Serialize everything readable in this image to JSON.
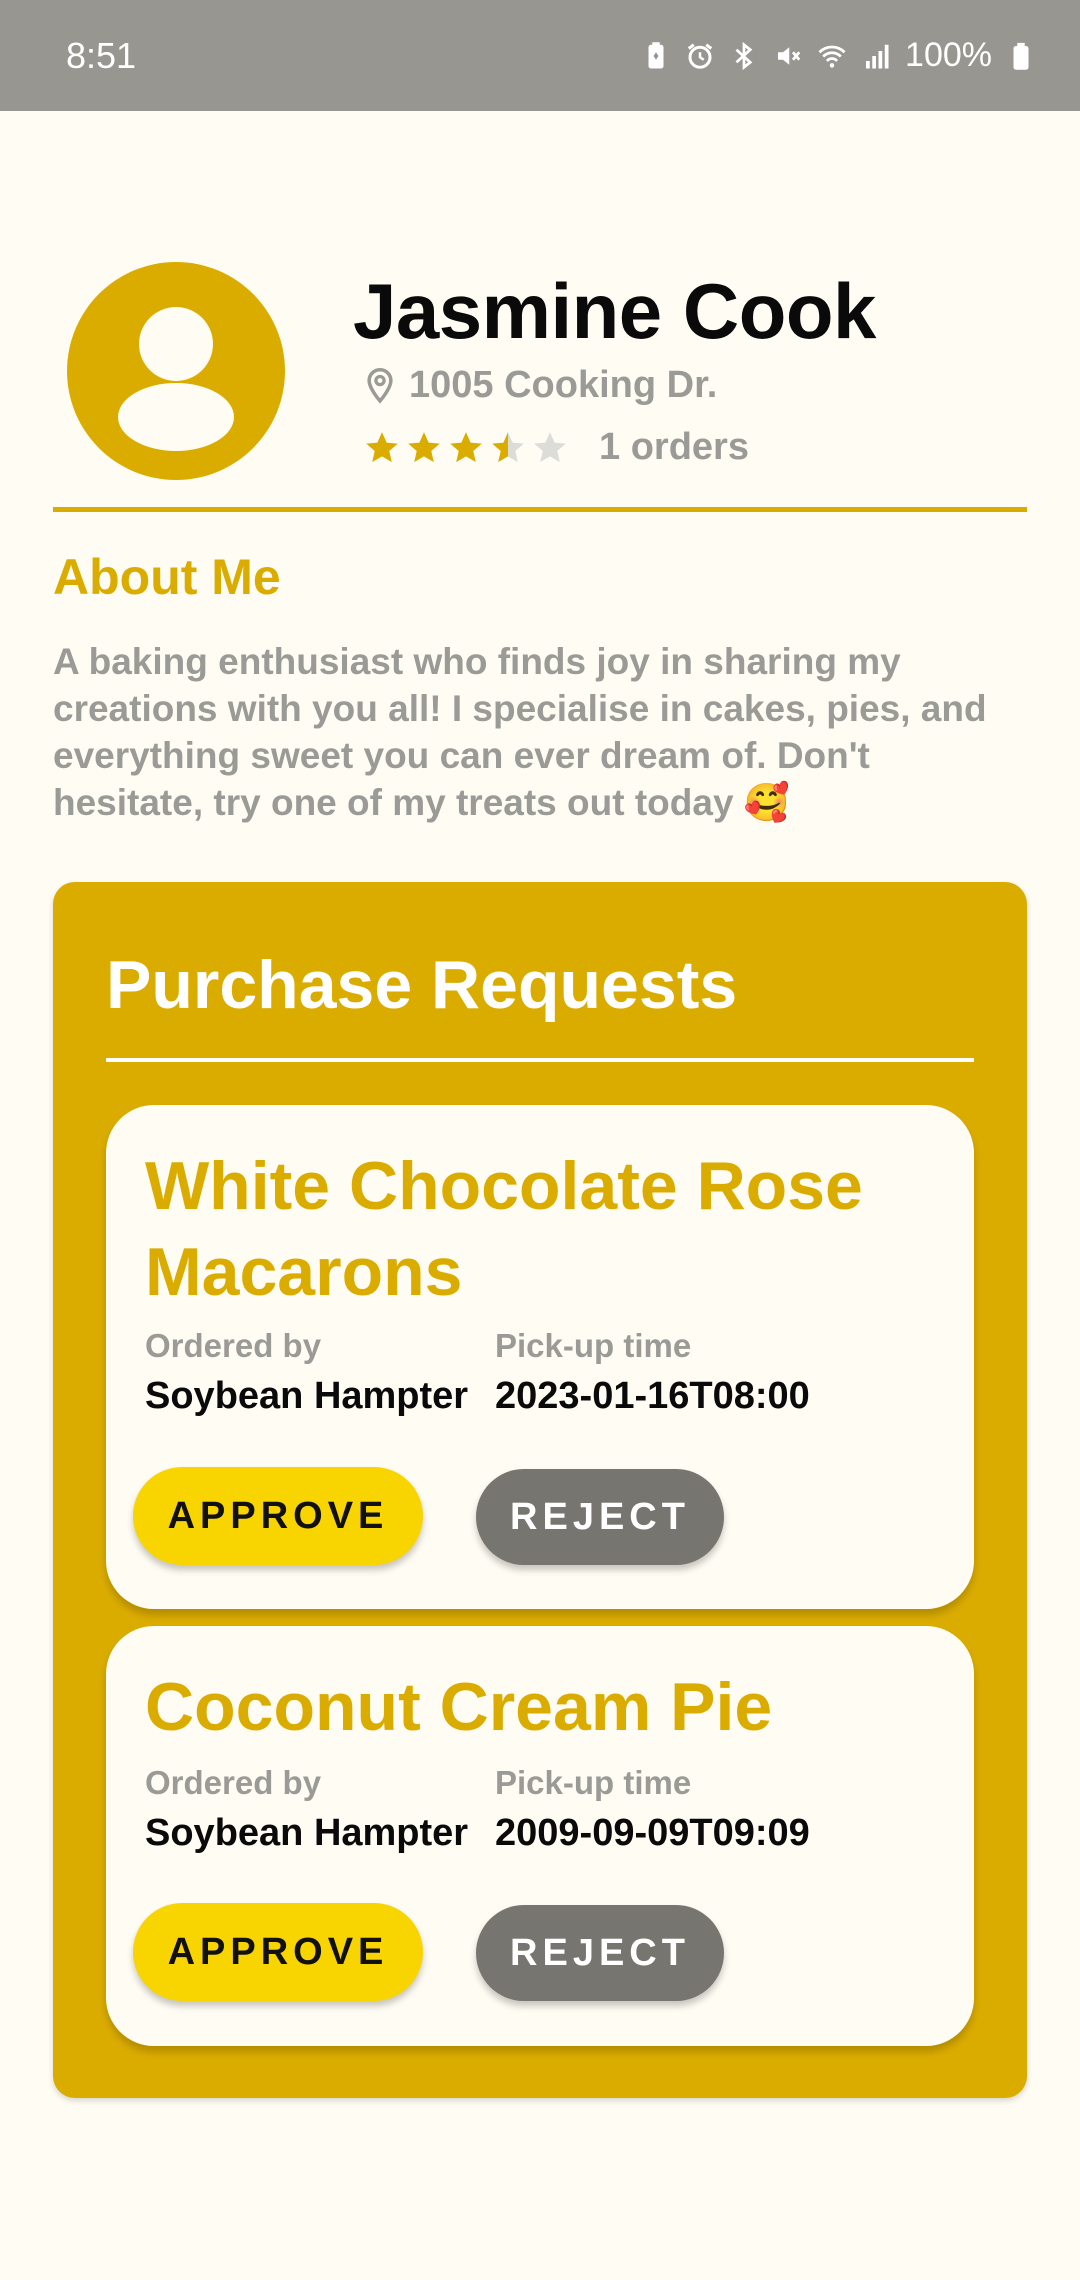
{
  "status_bar": {
    "time": "8:51",
    "battery": "100%",
    "icons": [
      "battery-saver-icon",
      "alarm-icon",
      "bluetooth-icon",
      "mute-icon",
      "wifi-icon",
      "signal-4g-icon",
      "battery-icon"
    ]
  },
  "profile": {
    "name": "Jasmine Cook",
    "address": "1005 Cooking Dr.",
    "rating": 3.5,
    "rating_max": 5,
    "orders": "1 orders"
  },
  "about": {
    "title": "About Me",
    "text": "A baking enthusiast who finds joy in sharing my creations with you all! I specialise in cakes, pies, and everything sweet you can ever dream of. Don't hesitate, try one of my treats out today 🥰"
  },
  "requests": {
    "title": "Purchase Requests",
    "ordered_by_label": "Ordered by",
    "pickup_label": "Pick-up time",
    "approve_label": "APPROVE",
    "reject_label": "REJECT",
    "items": [
      {
        "name": "White Chocolate Rose Macarons",
        "ordered_by": "Soybean Hampter",
        "pickup_time": "2023-01-16T08:00"
      },
      {
        "name": "Coconut Cream Pie",
        "ordered_by": "Soybean Hampter",
        "pickup_time": "2009-09-09T09:09"
      }
    ]
  },
  "colors": {
    "accent": "#dbac00",
    "approve": "#f8d500",
    "reject": "#77756f",
    "background": "#fffcf3",
    "muted_text": "#9a9a96"
  }
}
